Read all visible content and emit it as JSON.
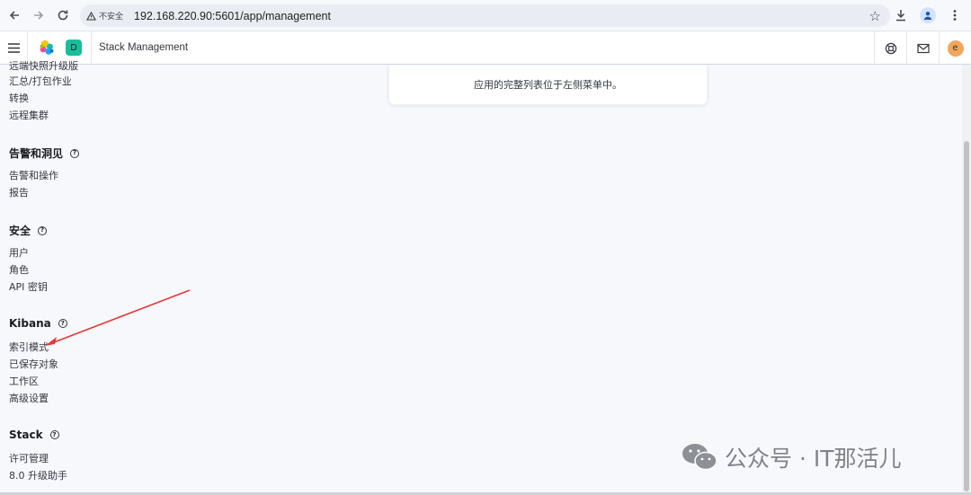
{
  "browser": {
    "security_label": "不安全",
    "url": "192.168.220.90:5601/app/management"
  },
  "header": {
    "space_initial": "D",
    "breadcrumb": "Stack Management",
    "user_initial": "e"
  },
  "sidebar": {
    "partial_item": "远端快照升级版",
    "group_data_items": [
      "汇总/打包作业",
      "转换",
      "远程集群"
    ],
    "sections": [
      {
        "title": "告警和洞见",
        "items": [
          "告警和操作",
          "报告"
        ]
      },
      {
        "title": "安全",
        "items": [
          "用户",
          "角色",
          "API 密钥"
        ]
      },
      {
        "title": "Kibana",
        "items": [
          "索引模式",
          "已保存对象",
          "工作区",
          "高级设置"
        ]
      },
      {
        "title": "Stack",
        "items": [
          "许可管理",
          "8.0 升级助手"
        ]
      }
    ]
  },
  "main": {
    "panel_text": "应用的完整列表位于左侧菜单中。"
  },
  "watermark": {
    "text": "公众号 · IT那活儿"
  },
  "colors": {
    "space_badge": "#1abc9c",
    "avatar": "#f2a65a",
    "annotation_arrow": "#e53935"
  }
}
